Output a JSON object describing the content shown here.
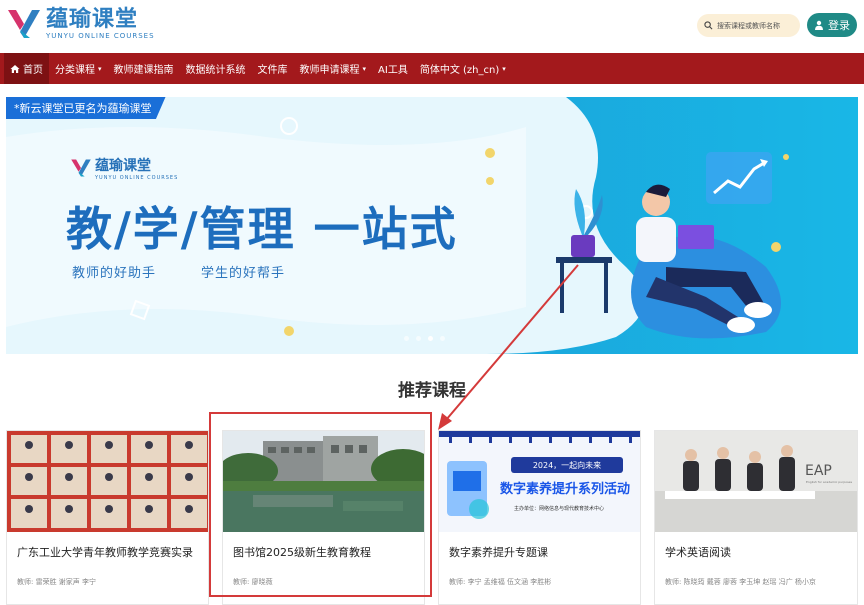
{
  "header": {
    "logo_cn": "蕴瑜课堂",
    "logo_en": "YUNYU ONLINE COURSES",
    "search_placeholder": "搜索课程或教师名称",
    "login_label": "登录"
  },
  "nav": {
    "items": [
      {
        "label": "首页",
        "icon": "home-icon",
        "caret": false
      },
      {
        "label": "分类课程",
        "caret": true
      },
      {
        "label": "教师建课指南",
        "caret": false
      },
      {
        "label": "数据统计系统",
        "caret": false
      },
      {
        "label": "文件库",
        "caret": false
      },
      {
        "label": "教师申请课程",
        "caret": true
      },
      {
        "label": "AI工具",
        "caret": false
      },
      {
        "label": "简体中文 (zh_cn)",
        "caret": true
      }
    ]
  },
  "banner": {
    "ribbon": "*新云课堂已更名为蕴瑜课堂",
    "logo_cn": "蕴瑜课堂",
    "logo_en": "YUNYU ONLINE COURSES",
    "headline": "教/学/管理 一站式",
    "sub1": "教师的好助手",
    "sub2": "学生的好帮手",
    "slides": 4,
    "active_slide": 3
  },
  "section": {
    "title": "推荐课程"
  },
  "courses": [
    {
      "title": "广东工业大学青年教师教学竞赛实录",
      "teacher": "教师: 雷荣胜 谢家声 李宁"
    },
    {
      "title": "图书馆2025级新生教育教程",
      "teacher": "教师: 廖晓薇"
    },
    {
      "title": "数字素养提升专题课",
      "teacher": "教师: 李宁 孟维福 伍文涵 李胜彬"
    },
    {
      "title": "学术英语阅读",
      "teacher": "教师: 陈晓筠 戴蓉 廖蓉 李玉坤 赵瑶 冯广 杨小京"
    }
  ],
  "course3_poster": {
    "year_line": "2024，一起向未来",
    "headline": "数字素养提升系列活动",
    "organizer": "主办单位：网络信息与现代教育技术中心"
  },
  "course4_poster": {
    "label": "EAP",
    "sub": "English for academic purposes"
  },
  "colors": {
    "nav_bg": "#a3191c",
    "login_bg": "#1f8a86",
    "highlight": "#d43a3a"
  }
}
